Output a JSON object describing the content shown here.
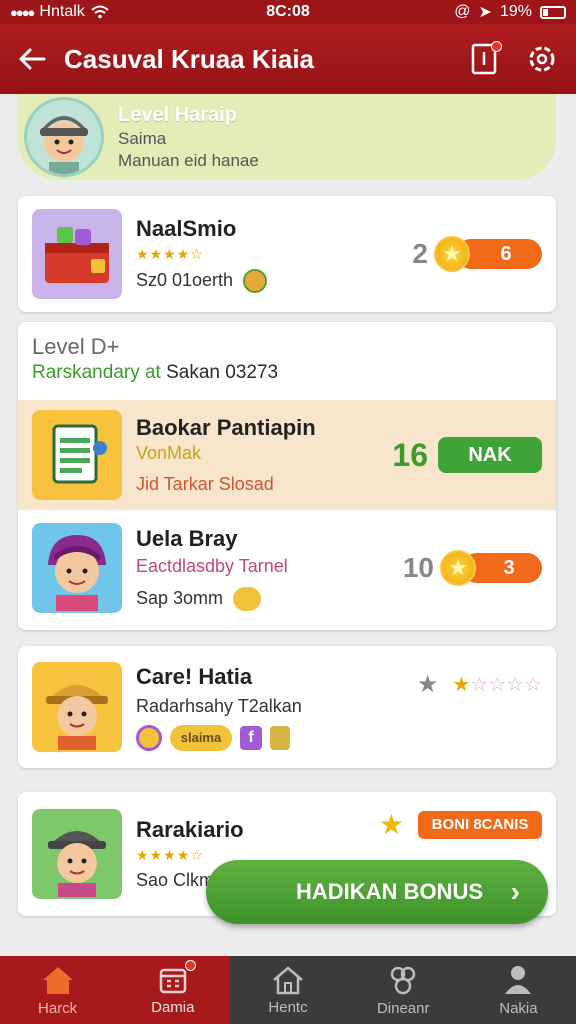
{
  "status_bar": {
    "carrier": "Hntalk",
    "time": "8C:08",
    "battery": "19%"
  },
  "app_bar": {
    "title": "Casuval Kruaa Kiaia",
    "back_icon": "arrow-left-icon",
    "doc_icon": "document-icon",
    "settings_icon": "gear-icon"
  },
  "profile": {
    "level": "Level Haraip",
    "line1": "Saima",
    "line2": "Manuan eid hanae"
  },
  "items": [
    {
      "title": "NaalSmio",
      "line": "Sz0 01oerth",
      "score": "2",
      "pill": "6",
      "pill_color": "#f06a1a"
    }
  ],
  "section": {
    "heading": "Level D+",
    "subheading_green": "Rarskandary at",
    "subheading_rest": "Sakan 03273",
    "highlight": {
      "title": "Baokar Pantiapin",
      "sub1": "VonMak",
      "sub2": "Jid Tarkar Slosad",
      "score": "16",
      "button": "NAK"
    },
    "second": {
      "title": "Uela Bray",
      "sub1": "Eactdlasdby Tarnel",
      "sub2": "Sap 3omm",
      "score": "10",
      "pill": "3"
    }
  },
  "card3": {
    "title": "Care! Hatia",
    "line": "Radarhsahy T2alkan",
    "badge": "slaima"
  },
  "card4": {
    "title": "Rarakiario",
    "line": "Sao Clkm",
    "badge": "BONI 8CANIS"
  },
  "fab": {
    "label": "HADIKAN BONUS",
    "chevron": "›"
  },
  "nav": [
    {
      "label": "Harck",
      "icon": "home-icon"
    },
    {
      "label": "Damia",
      "icon": "calendar-icon"
    },
    {
      "label": "Hentc",
      "icon": "house-icon"
    },
    {
      "label": "Dineanr",
      "icon": "people-icon"
    },
    {
      "label": "Nakia",
      "icon": "person-icon"
    }
  ],
  "colors": {
    "primary": "#a8191c",
    "green": "#4ca636",
    "orange": "#f06a1a"
  }
}
